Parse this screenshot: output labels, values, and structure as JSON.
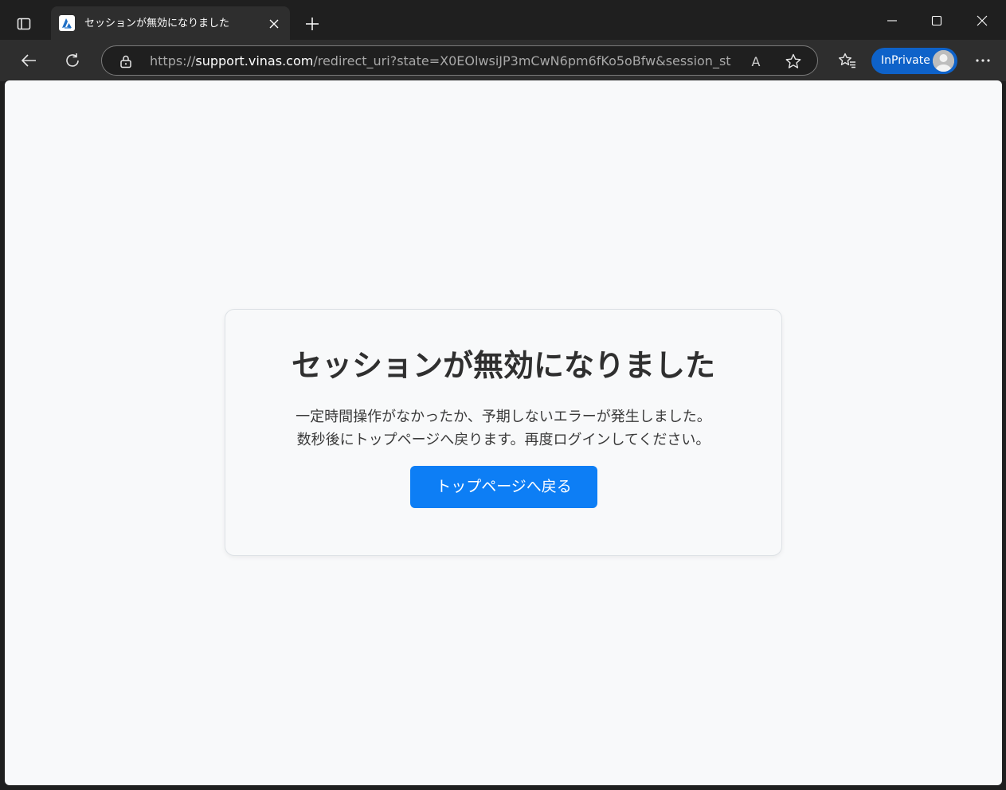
{
  "browser": {
    "tab": {
      "title": "セッションが無効になりました"
    },
    "address": {
      "scheme": "https://",
      "host": "support.vinas.com",
      "path": "/redirect_uri?state=X0EOlwsiJP3mCwN6pm6fKo5oBfw&session_st..."
    },
    "read_aloud_label": "A",
    "inprivate_label": "InPrivate",
    "icons": {
      "tab_actions": "tab-actions-icon",
      "favicon": "azure-logo-icon",
      "close": "close-icon",
      "new_tab": "plus-icon",
      "back": "arrow-left-icon",
      "refresh": "refresh-icon",
      "lock": "lock-icon",
      "read_aloud": "read-aloud-icon",
      "favorite": "star-icon",
      "favorites": "favorites-icon",
      "more": "more-icon"
    }
  },
  "page": {
    "heading": "セッションが無効になりました",
    "message_line1": "一定時間操作がなかったか、予期しないエラーが発生しました。",
    "message_line2": "数秒後にトップページへ戻ります。再度ログインしてください。",
    "button_label": "トップページへ戻る"
  },
  "colors": {
    "chrome_dark": "#1f1f1f",
    "toolbar": "#2e2e2e",
    "inprivate_badge": "#0e62c9",
    "page_background": "#f8f9fa",
    "primary_button": "#0d7ef5",
    "heading_text": "#2f2f2f"
  }
}
